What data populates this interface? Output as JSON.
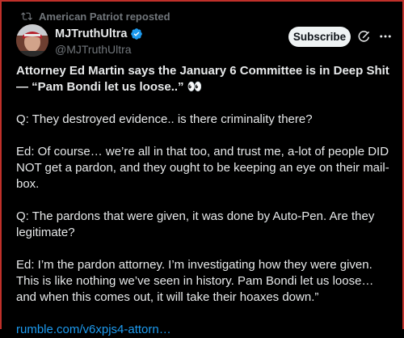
{
  "repost": {
    "label": "American Patriot reposted",
    "icon": "repost-icon"
  },
  "author": {
    "name": "MJTruthUltra",
    "handle": "@MJTruthUltra",
    "verified_color": "#1d9bf0"
  },
  "actions": {
    "subscribe_label": "Subscribe"
  },
  "post": {
    "title": "Attorney Ed Martin says the January 6 Committee is in Deep Shit — “Pam Bondi let us loose..” 👀",
    "paragraphs": [
      "Q: They destroyed evidence.. is there criminality there?",
      "Ed: Of course… we’re all in that too, and trust me, a-lot of people DID NOT get a pardon, and they ought to be keeping an eye on their mail-box.",
      "Q: The pardons that were given, it was done by Auto-Pen. Are they legitimate?",
      "Ed: I’m the pardon attorney. I’m investigating how they were given. This is like nothing we’ve seen in history. Pam Bondi let us loose… and when this comes out, it will take their hoaxes down.”"
    ],
    "link": "rumble.com/v6xpjs4-attorn…"
  },
  "colors": {
    "accent": "#1d9bf0",
    "muted": "#71767b",
    "text": "#e7e9ea",
    "background": "#000000",
    "frame": "#c0302a"
  }
}
